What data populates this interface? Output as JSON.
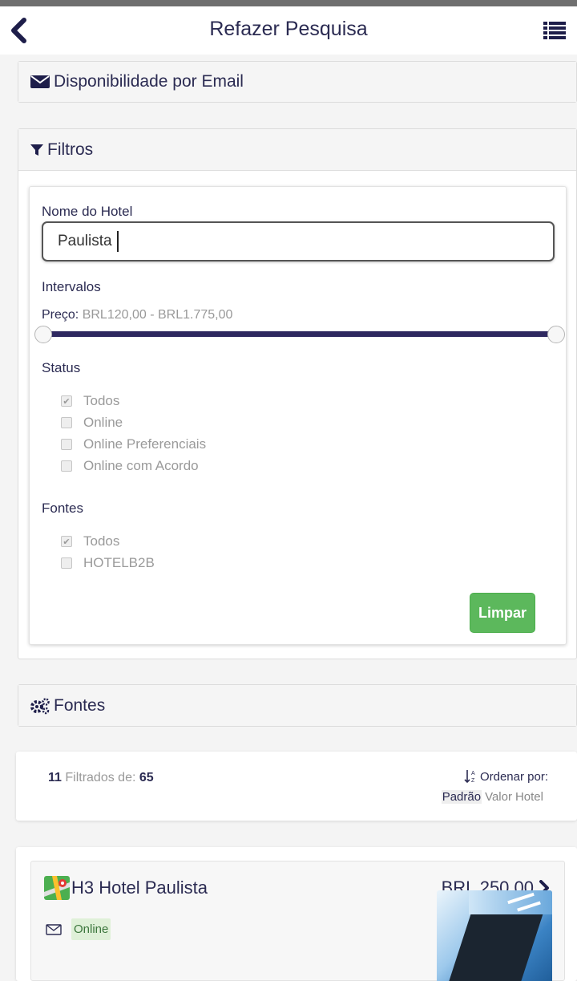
{
  "header": {
    "title": "Refazer Pesquisa",
    "back_icon": "chevron-left-icon",
    "menu_icon": "list-icon"
  },
  "email_panel": {
    "title": "Disponibilidade por Email",
    "icon": "envelope-icon"
  },
  "filters_panel": {
    "title": "Filtros",
    "icon": "filter-icon",
    "hotel_name": {
      "label": "Nome do Hotel",
      "value": "Paulista"
    },
    "ranges": {
      "label": "Intervalos",
      "price_label": "Preço:",
      "price_value": "BRL120,00 - BRL1.775,00",
      "slider_min_fraction": 0,
      "slider_max_fraction": 1
    },
    "status": {
      "label": "Status",
      "options": [
        {
          "label": "Todos",
          "checked": true
        },
        {
          "label": "Online",
          "checked": false
        },
        {
          "label": "Online Preferenciais",
          "checked": false
        },
        {
          "label": "Online com Acordo",
          "checked": false
        }
      ]
    },
    "sources": {
      "label": "Fontes",
      "options": [
        {
          "label": "Todos",
          "checked": true
        },
        {
          "label": "HOTELB2B",
          "checked": false
        }
      ]
    },
    "clear_label": "Limpar"
  },
  "sources_panel": {
    "title": "Fontes",
    "icon": "gears-icon"
  },
  "summary": {
    "filtered_count": "11",
    "filtered_text": "Filtrados de:",
    "total": "65",
    "sort_label": "Ordenar por:",
    "sort_icon": "sort-alpha-icon",
    "sort_options": [
      "Padrão",
      "Valor",
      "Hotel"
    ],
    "sort_active": "Padrão"
  },
  "result": {
    "hotel_name": "H3 Hotel Paulista",
    "map_icon": "map-icon",
    "price": "BRL 250,00",
    "status_badge": "Online",
    "envelope_icon": "envelope-outline-icon"
  },
  "colors": {
    "primary_text": "#2b2b52",
    "slider": "#2e2860",
    "success": "#5cb85c"
  }
}
